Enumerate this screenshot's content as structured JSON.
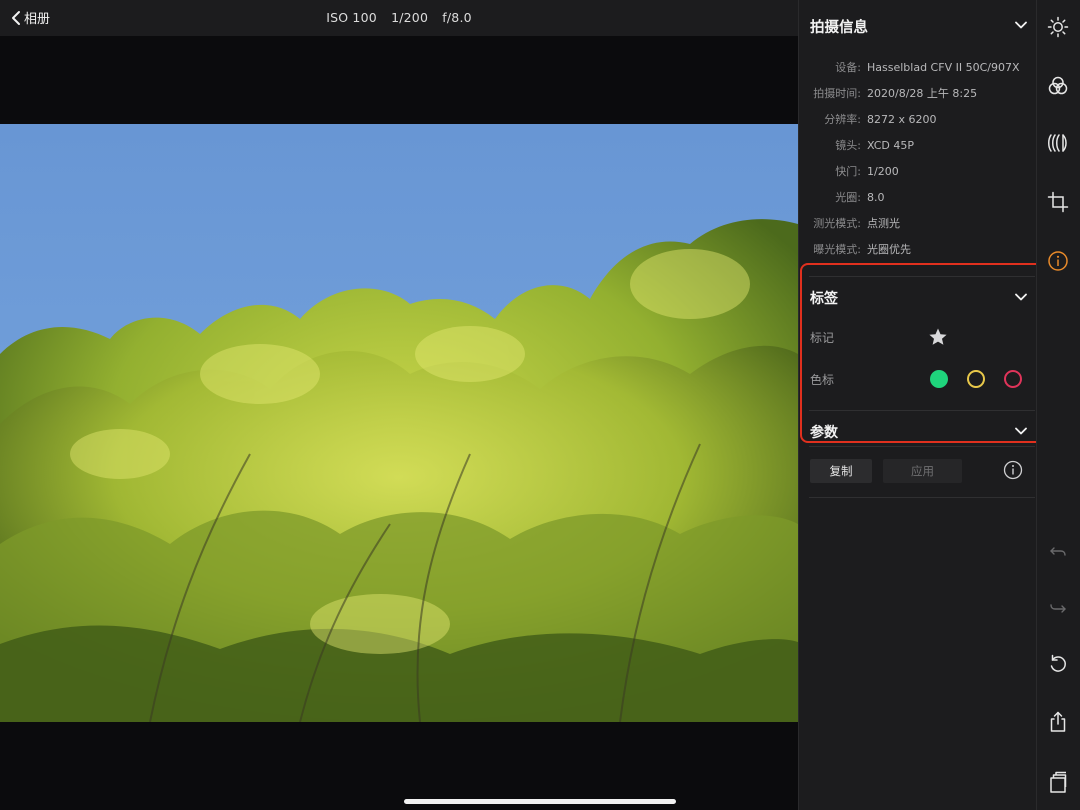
{
  "topbar": {
    "back_label": "相册",
    "iso": "ISO 100",
    "shutter": "1/200",
    "aperture": "f/8.0"
  },
  "panel": {
    "title": "拍摄信息",
    "info": [
      {
        "key": "设备:",
        "value": "Hasselblad CFV II 50C/907X"
      },
      {
        "key": "拍摄时间:",
        "value": "2020/8/28 上午 8:25"
      },
      {
        "key": "分辨率:",
        "value": "8272 x 6200"
      },
      {
        "key": "镜头:",
        "value": "XCD 45P"
      },
      {
        "key": "快门:",
        "value": "1/200"
      },
      {
        "key": "光圈:",
        "value": "8.0"
      },
      {
        "key": "测光模式:",
        "value": "点测光"
      },
      {
        "key": "曝光模式:",
        "value": "光圈优先"
      }
    ],
    "tags": {
      "title": "标签",
      "mark_label": "标记",
      "color_label": "色标",
      "colors": [
        "#1fd47c",
        "#e8c84a",
        "#e0345a"
      ]
    },
    "params": {
      "title": "参数"
    },
    "buttons": {
      "copy": "复制",
      "apply": "应用"
    }
  },
  "colors": {
    "sky": "#6f9fd8",
    "highlight": "#e0301e",
    "active_tool": "#e88a2a"
  },
  "tools": [
    "light-icon",
    "color-icon",
    "curve-icon",
    "crop-icon",
    "info-icon",
    "undo-icon",
    "redo-icon",
    "reset-icon",
    "share-icon",
    "compare-icon"
  ]
}
